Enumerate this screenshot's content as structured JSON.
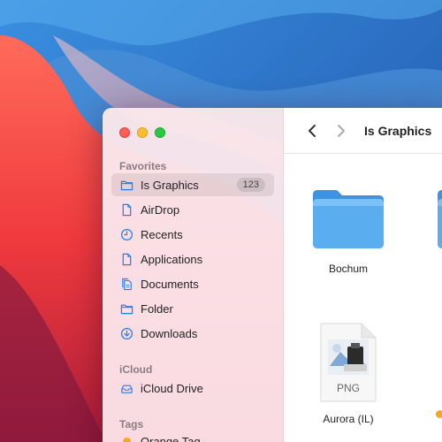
{
  "window": {
    "title": "Is Graphics"
  },
  "sidebar": {
    "favorites_label": "Favorites",
    "items": [
      {
        "label": "Is Graphics",
        "badge": "123",
        "icon": "folder-icon",
        "selected": true
      },
      {
        "label": "AirDrop",
        "icon": "document-icon"
      },
      {
        "label": "Recents",
        "icon": "clock-icon"
      },
      {
        "label": "Applications",
        "icon": "document-icon"
      },
      {
        "label": "Documents",
        "icon": "documents-icon"
      },
      {
        "label": "Folder",
        "icon": "folder-icon"
      },
      {
        "label": "Downloads",
        "icon": "download-icon"
      }
    ],
    "icloud_label": "iCloud",
    "icloud_items": [
      {
        "label": "iCloud Drive",
        "icon": "cloud-drive-icon"
      }
    ],
    "tags_label": "Tags",
    "tag_items": [
      {
        "label": "Orange Tag",
        "color": "#f5a623"
      }
    ]
  },
  "files": [
    {
      "name": "Bochum",
      "kind": "folder"
    },
    {
      "name": "Aurora (IL)",
      "kind": "png",
      "badge_text": "PNG"
    }
  ],
  "colors": {
    "accent": "#1e7ef7",
    "folder": "#5aaef0",
    "tag_orange": "#f5a623"
  }
}
